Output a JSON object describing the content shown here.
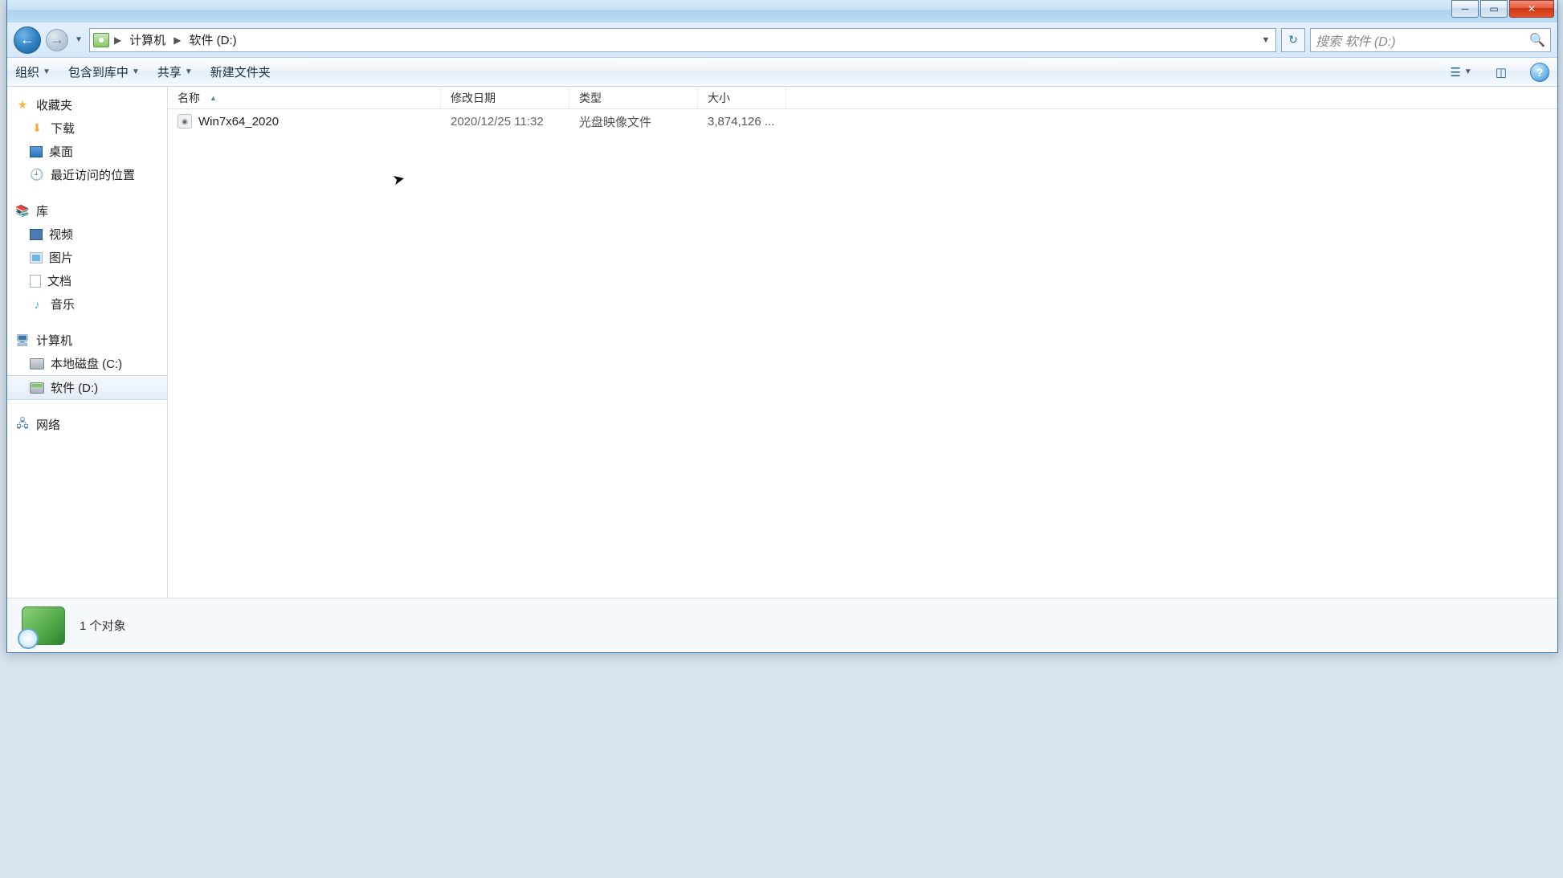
{
  "breadcrumb": {
    "parts": [
      "计算机",
      "软件 (D:)"
    ]
  },
  "search": {
    "placeholder": "搜索 软件 (D:)"
  },
  "toolbar": {
    "organize": "组织",
    "include": "包含到库中",
    "share": "共享",
    "newfolder": "新建文件夹"
  },
  "columns": {
    "name": "名称",
    "date": "修改日期",
    "type": "类型",
    "size": "大小"
  },
  "sidebar": {
    "favorites": "收藏夹",
    "downloads": "下载",
    "desktop": "桌面",
    "recent": "最近访问的位置",
    "libraries": "库",
    "videos": "视频",
    "pictures": "图片",
    "documents": "文档",
    "music": "音乐",
    "computer": "计算机",
    "localC": "本地磁盘 (C:)",
    "softD": "软件 (D:)",
    "network": "网络"
  },
  "files": [
    {
      "name": "Win7x64_2020",
      "date": "2020/12/25 11:32",
      "type": "光盘映像文件",
      "size": "3,874,126 ..."
    }
  ],
  "status": {
    "text": "1 个对象"
  }
}
